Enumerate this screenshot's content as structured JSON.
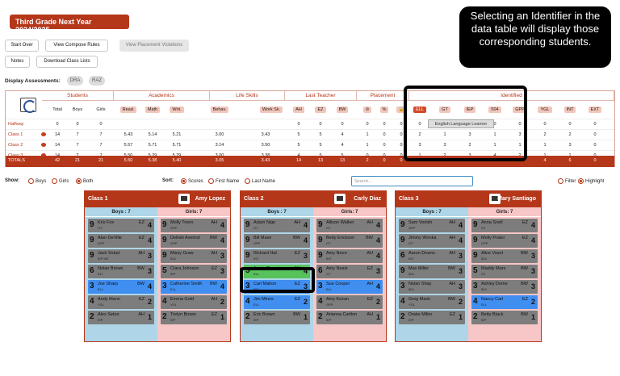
{
  "title": "Third Grade Next Year 2024/2025",
  "callout": "Selecting an Identifier in the data table will display those corresponding students.",
  "buttons": {
    "start_over": "Start Over",
    "compose_rules": "View Compose Rules",
    "placement_violations": "View Placement Violations",
    "notes": "Notes",
    "download": "Download Class Lists"
  },
  "assessments": {
    "label": "Display Assessments:",
    "items": [
      "DRA",
      "RAZ"
    ]
  },
  "table": {
    "groups": [
      "Students",
      "Academics",
      "Life Skills",
      "Last Teacher",
      "Placement",
      "Identified"
    ],
    "sub": [
      "Total",
      "Boys",
      "Girls",
      "Read.",
      "Math",
      "Writ.",
      "Behav.",
      "Work Sk.",
      "AH",
      "EZ",
      "BW",
      "⊘",
      "%",
      "🔒",
      "ELL",
      "GT",
      "IEP",
      "504",
      "GPP",
      "YGL",
      "INT",
      "EXT"
    ],
    "rows": [
      {
        "name": "Halfway",
        "cells": [
          "0",
          "0",
          "0",
          "",
          "",
          "",
          "",
          "",
          "0",
          "0",
          "0",
          "0",
          "0",
          "0",
          "0",
          "0",
          "0",
          "0",
          "0",
          "0",
          "0",
          "0"
        ]
      },
      {
        "name": "Class 1",
        "cells": [
          "14",
          "7",
          "7",
          "5.43",
          "5.14",
          "5.21",
          "3.00",
          "3.43",
          "5",
          "5",
          "4",
          "1",
          "0",
          "0",
          "2",
          "1",
          "3",
          "1",
          "3",
          "2",
          "2",
          "0"
        ]
      },
      {
        "name": "Class 2",
        "cells": [
          "14",
          "7",
          "7",
          "5.57",
          "5.71",
          "5.71",
          "3.14",
          "3.50",
          "5",
          "5",
          "4",
          "1",
          "0",
          "0",
          "3",
          "3",
          "2",
          "1",
          "1",
          "1",
          "3",
          "0"
        ]
      },
      {
        "name": "Class 3",
        "cells": [
          "14",
          "7",
          "7",
          "5.50",
          "5.29",
          "5.29",
          "3.00",
          "3.38",
          "4",
          "5",
          "5",
          "0",
          "0",
          "0",
          "1",
          "2",
          "3",
          "4",
          "2",
          "1",
          "1",
          "0"
        ]
      },
      {
        "name": "TOTALS",
        "cells": [
          "42",
          "21",
          "21",
          "5.50",
          "5.38",
          "5.40",
          "3.05",
          "3.43",
          "14",
          "13",
          "13",
          "2",
          "0",
          "0",
          "6",
          "6",
          "8",
          "6",
          "6",
          "4",
          "6",
          "0"
        ]
      }
    ]
  },
  "tooltip": "English Language Learner",
  "controls": {
    "show_label": "Show:",
    "show": [
      "Boys",
      "Girls",
      "Both"
    ],
    "sort_label": "Sort:",
    "sort": [
      "Scores",
      "First Name",
      "Last Name"
    ],
    "search_placeholder": "Search...",
    "filter": "Filter",
    "highlight": "Highlight"
  },
  "classes": [
    {
      "name": "Class 1",
      "teacher": "Amy Lopez",
      "boys_label": "Boys : 7",
      "girls_label": "Girls: 7",
      "boys": [
        {
          "n": "9",
          "name": "Kris Fox",
          "sub": "GT",
          "tr": "EZ",
          "s": "4",
          "c": "gray"
        },
        {
          "n": "9",
          "name": "Alan DeVille",
          "sub": "GPP",
          "tr": "EZ",
          "s": "4",
          "c": "gray"
        },
        {
          "n": "9",
          "name": "Jack Sotud",
          "sub": "IEP INT",
          "tr": "AH",
          "s": "3",
          "c": "gray"
        },
        {
          "n": "6",
          "name": "Nolan Brown",
          "sub": "INT",
          "tr": "BW",
          "s": "3",
          "c": "gray"
        },
        {
          "n": "3",
          "name": "Joe Sharp",
          "sub": "ELL",
          "tr": "BW",
          "s": "4",
          "c": "blue"
        },
        {
          "n": "4",
          "name": "Andy Mann",
          "sub": "YGL",
          "tr": "EZ",
          "s": "2",
          "c": "gray"
        },
        {
          "n": "2",
          "name": "Alex Seton",
          "sub": "IEP",
          "tr": "AH",
          "s": "1",
          "c": "gray"
        }
      ],
      "girls": [
        {
          "n": "9",
          "name": "Molly Treen",
          "sub": "GPP",
          "tr": "AH",
          "s": "4",
          "c": "gray"
        },
        {
          "n": "9",
          "name": "Delilah Axelrod",
          "sub": "GPP",
          "tr": "BW",
          "s": "4",
          "c": "gray"
        },
        {
          "n": "9",
          "name": "Missy Graw",
          "sub": "504",
          "tr": "AH",
          "s": "3",
          "c": "gray"
        },
        {
          "n": "5",
          "name": "Ciara Johnson",
          "sub": "IEP",
          "tr": "EZ",
          "s": "3",
          "c": "gray"
        },
        {
          "n": "3",
          "name": "Catherine Smith",
          "sub": "ELL",
          "tr": "BW",
          "s": "4",
          "c": "blue"
        },
        {
          "n": "4",
          "name": "Emma Gold",
          "sub": "YGL",
          "tr": "AH",
          "s": "2",
          "c": "gray"
        },
        {
          "n": "2",
          "name": "Trelyn Brown",
          "sub": "IEP",
          "tr": "EZ",
          "s": "1",
          "c": "gray"
        }
      ]
    },
    {
      "name": "Class 2",
      "teacher": "Carly Diaz",
      "boys_label": "Boys : 7",
      "girls_label": "Girls: 7",
      "boys": [
        {
          "n": "9",
          "name": "Adam Nigo",
          "sub": "GT",
          "tr": "AH",
          "s": "4",
          "c": "gray"
        },
        {
          "n": "9",
          "name": "Bill Maze",
          "sub": "GPP",
          "tr": "BW",
          "s": "4",
          "c": "gray"
        },
        {
          "n": "9",
          "name": "Richard Hal",
          "sub": "INT",
          "tr": "EZ",
          "s": "3",
          "c": "gray"
        },
        {
          "n": "5",
          "name": "Jamie Rosario",
          "sub": "ELL",
          "tr": "AH",
          "s": "4",
          "c": "green"
        },
        {
          "n": "3",
          "name": "Carl Mahon",
          "sub": "504",
          "tr": "EZ",
          "s": "3",
          "c": "blue"
        },
        {
          "n": "4",
          "name": "Jim Minns",
          "sub": "ELL",
          "tr": "EZ",
          "s": "2",
          "c": "blue"
        },
        {
          "n": "2",
          "name": "Eric Brown",
          "sub": "IEP",
          "tr": "BW",
          "s": "1",
          "c": "gray"
        }
      ],
      "girls": [
        {
          "n": "9",
          "name": "Allison Walker",
          "sub": "GT",
          "tr": "AH",
          "s": "4",
          "c": "gray"
        },
        {
          "n": "9",
          "name": "Betty Erickson",
          "sub": "GT",
          "tr": "BW",
          "s": "4",
          "c": "gray"
        },
        {
          "n": "9",
          "name": "Amy Noon",
          "sub": "INT",
          "tr": "AH",
          "s": "4",
          "c": "gray"
        },
        {
          "n": "6",
          "name": "Amy Neals",
          "sub": "GT",
          "tr": "EZ",
          "s": "3",
          "c": "gray"
        },
        {
          "n": "3",
          "name": "Sue Cooper",
          "sub": "ELL",
          "tr": "AH",
          "s": "4",
          "c": "blue"
        },
        {
          "n": "4",
          "name": "Amy Kozan",
          "sub": "GPP",
          "tr": "EZ",
          "s": "2",
          "c": "gray"
        },
        {
          "n": "2",
          "name": "Arianna Carlton",
          "sub": "IEP",
          "tr": "AH",
          "s": "1",
          "c": "gray"
        }
      ]
    },
    {
      "name": "Class 3",
      "teacher": "Mary Santiago",
      "boys_label": "Boys : 7",
      "girls_label": "Girls: 7",
      "boys": [
        {
          "n": "9",
          "name": "Sam Vonish",
          "sub": "GPP",
          "tr": "AH",
          "s": "4",
          "c": "gray"
        },
        {
          "n": "9",
          "name": "Jimmy Wonka",
          "sub": "GT",
          "tr": "AH",
          "s": "4",
          "c": "gray"
        },
        {
          "n": "6",
          "name": "Aaron Downs",
          "sub": "INT",
          "tr": "AH",
          "s": "3",
          "c": "gray"
        },
        {
          "n": "9",
          "name": "Max Miller",
          "sub": "504",
          "tr": "BW",
          "s": "3",
          "c": "gray"
        },
        {
          "n": "3",
          "name": "Nolan Shay",
          "sub": "504",
          "tr": "AH",
          "s": "3",
          "c": "gray"
        },
        {
          "n": "4",
          "name": "Greg Mash",
          "sub": "YGL",
          "tr": "BW",
          "s": "2",
          "c": "gray"
        },
        {
          "n": "2",
          "name": "Drake Miller",
          "sub": "IEP",
          "tr": "EZ",
          "s": "1",
          "c": "gray"
        }
      ],
      "girls": [
        {
          "n": "9",
          "name": "Anna Snell",
          "sub": "GT",
          "tr": "EZ",
          "s": "4",
          "c": "gray"
        },
        {
          "n": "9",
          "name": "Molly Prater",
          "sub": "GPP",
          "tr": "EZ",
          "s": "4",
          "c": "gray"
        },
        {
          "n": "9",
          "name": "Alice Vozel",
          "sub": "504",
          "tr": "BW",
          "s": "3",
          "c": "gray"
        },
        {
          "n": "5",
          "name": "Maddy Marx",
          "sub": "GT",
          "tr": "BW",
          "s": "3",
          "c": "gray"
        },
        {
          "n": "3",
          "name": "Ashley Dome",
          "sub": "504",
          "tr": "BW",
          "s": "3",
          "c": "gray"
        },
        {
          "n": "4",
          "name": "Nancy Carl",
          "sub": "ELL",
          "tr": "EZ",
          "s": "2",
          "c": "blue"
        },
        {
          "n": "2",
          "name": "Betty Black",
          "sub": "IEP",
          "tr": "BW",
          "s": "1",
          "c": "gray"
        }
      ]
    }
  ]
}
